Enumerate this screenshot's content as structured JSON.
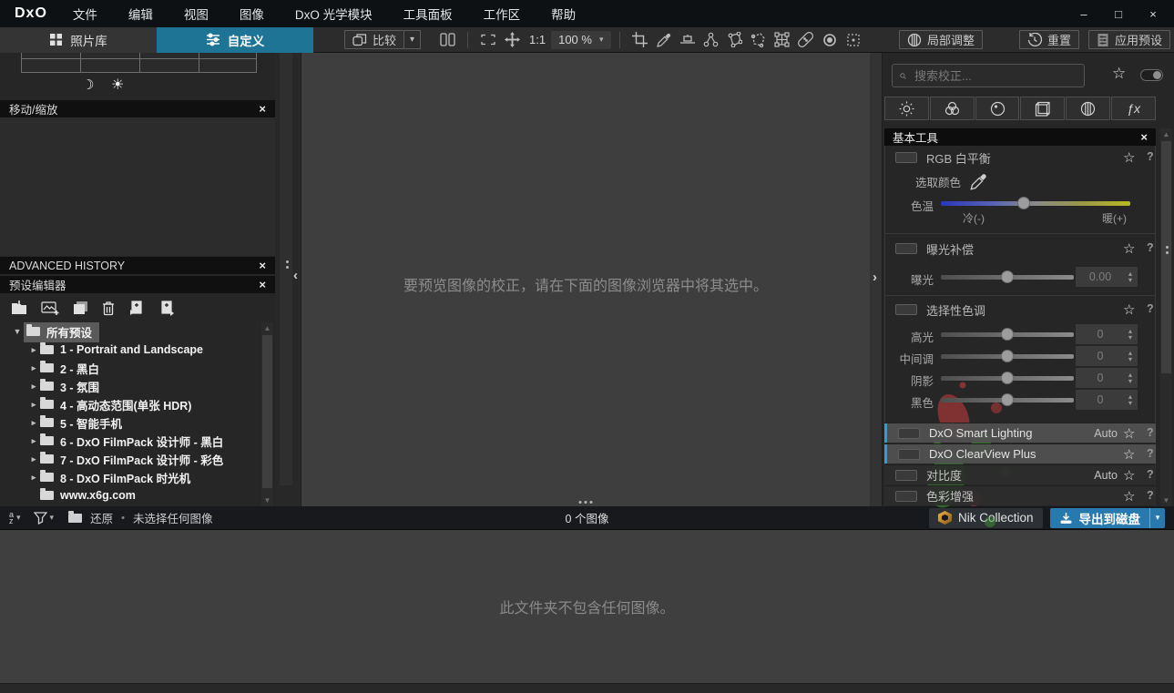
{
  "glyphs": {
    "minimize": "–",
    "maximize": "□",
    "close_win": "×",
    "caret_down": "▾",
    "tri_right": "▸",
    "tri_down": "▼",
    "chevron_left": "‹",
    "chevron_right": "›",
    "scroll_up": "▲",
    "scroll_down": "▼",
    "star": "☆",
    "help": "?",
    "close": "×",
    "moon": "☽",
    "sun": "☀",
    "stepper_up": "▴",
    "stepper_down": "▾",
    "bullet": "•",
    "fx": "ƒx"
  },
  "window": {
    "logo": "DxO",
    "menus": [
      "文件",
      "编辑",
      "视图",
      "图像",
      "DxO 光学模块",
      "工具面板",
      "工作区",
      "帮助"
    ]
  },
  "toolbar": {
    "library_tab": "照片库",
    "customize_tab": "自定义",
    "compare": "比较",
    "ratio": "1:1",
    "zoom": "100 %",
    "local_adjust": "局部调整",
    "reset": "重置",
    "apply_preset": "应用预设"
  },
  "left": {
    "move_zoom_title": "移动/缩放",
    "advanced_history_title": "ADVANCED HISTORY",
    "preset_editor_title": "预设编辑器",
    "tree_root": "所有预设",
    "tree": [
      "1 - Portrait and Landscape",
      "2 - 黑白",
      "3 - 氛围",
      "4 - 高动态范围(单张 HDR)",
      "5 - 智能手机",
      "6 - DxO FilmPack 设计师 - 黑白",
      "7 - DxO FilmPack 设计师 - 彩色",
      "8 - DxO FilmPack 时光机",
      "www.x6g.com"
    ]
  },
  "viewer": {
    "message": "要预览图像的校正，请在下面的图像浏览器中将其选中。"
  },
  "right": {
    "search_placeholder": "搜索校正...",
    "basic_tools": "基本工具",
    "white_balance": {
      "title": "RGB 白平衡",
      "pick": "选取颜色",
      "temp": "色温",
      "cold": "冷(-)",
      "warm": "暖(+)"
    },
    "exposure": {
      "title": "曝光补偿",
      "slider": "曝光",
      "value": "0.00"
    },
    "selective_tone": {
      "title": "选择性色调",
      "sliders": [
        {
          "label": "高光",
          "value": "0"
        },
        {
          "label": "中间调",
          "value": "0"
        },
        {
          "label": "阴影",
          "value": "0"
        },
        {
          "label": "黑色",
          "value": "0"
        }
      ]
    },
    "tools": [
      {
        "label": "DxO Smart Lighting",
        "badge": "Auto"
      },
      {
        "label": "DxO ClearView Plus",
        "badge": ""
      },
      {
        "label": "对比度",
        "badge": "Auto"
      },
      {
        "label": "色彩增强",
        "badge": ""
      }
    ]
  },
  "statusbar": {
    "sort_a": "a",
    "sort_z": "z",
    "restore": "还原",
    "selection": "未选择任何图像",
    "count": "0 个图像",
    "nik": "Nik Collection",
    "export": "导出到磁盘"
  },
  "filmstrip": {
    "message": "此文件夹不包含任何图像。"
  },
  "colors": {
    "accent_tab": "#1d7495",
    "export_button": "#2879ad",
    "active_row_bar": "#2d9fd8",
    "temp_gradient_left": "#2a36c0",
    "temp_gradient_right": "#b6ba22",
    "watermark_red": "#b43a3a",
    "watermark_green": "#3f9b35"
  }
}
